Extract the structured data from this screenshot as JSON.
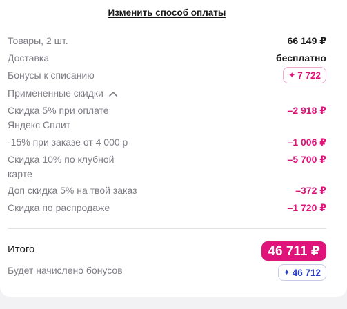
{
  "header": {
    "change_payment_link": "Изменить способ оплаты"
  },
  "summary": {
    "items_label": "Товары, 2 шт.",
    "items_value": "66 149 ₽",
    "delivery_label": "Доставка",
    "delivery_value": "бесплатно",
    "bonuses_label": "Бонусы к списанию",
    "bonuses_value": "7 722",
    "applied_discounts_label": "Примененные скидки"
  },
  "discounts": [
    {
      "label_line1": "Скидка 5% при оплате",
      "label_line2": "Яндекс Сплит",
      "value": "–2 918 ₽"
    },
    {
      "label_line1": "-15% при заказе от 4 000 р",
      "label_line2": "",
      "value": "–1 006 ₽"
    },
    {
      "label_line1": "Скидка 10% по клубной",
      "label_line2": "карте",
      "value": "–5 700 ₽"
    },
    {
      "label_line1": "Доп скидка 5% на твой заказ",
      "label_line2": "",
      "value": "–372 ₽"
    },
    {
      "label_line1": "Скидка по распродаже",
      "label_line2": "",
      "value": "–1 720 ₽"
    }
  ],
  "total": {
    "label": "Итого",
    "value": "46 711 ₽",
    "earn_label": "Будет начислено бонусов",
    "earn_value": "46 712"
  },
  "icons": {
    "spend_bonus": "sparkle-icon",
    "earn_bonus": "sparkle-icon",
    "collapse": "chevron-up-icon"
  },
  "colors": {
    "accent_pink": "#e0137a",
    "accent_blue": "#2b3fc9",
    "muted_text": "#7d7d85"
  }
}
